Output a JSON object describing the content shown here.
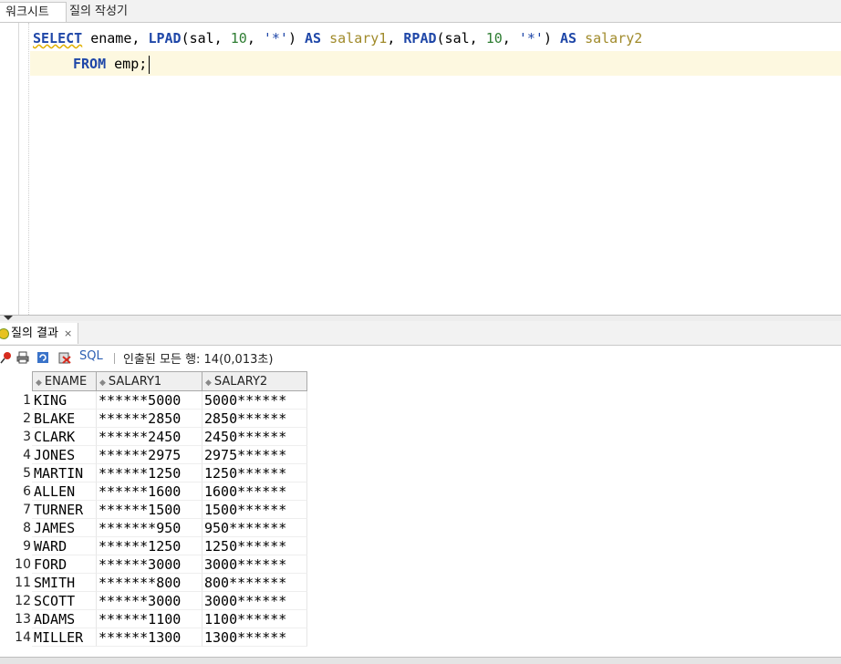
{
  "top_tabs": [
    "워크시트",
    "질의 작성기"
  ],
  "editor": {
    "line1": [
      {
        "t": "SELECT",
        "c": "kw squig"
      },
      {
        "t": " ename, ",
        "c": ""
      },
      {
        "t": "LPAD",
        "c": "kw"
      },
      {
        "t": "(sal, ",
        "c": ""
      },
      {
        "t": "10",
        "c": "num"
      },
      {
        "t": ", ",
        "c": ""
      },
      {
        "t": "'*'",
        "c": "str"
      },
      {
        "t": ") ",
        "c": ""
      },
      {
        "t": "AS",
        "c": "kw"
      },
      {
        "t": " ",
        "c": ""
      },
      {
        "t": "salary1",
        "c": "alias"
      },
      {
        "t": ", ",
        "c": ""
      },
      {
        "t": "RPAD",
        "c": "kw"
      },
      {
        "t": "(sal, ",
        "c": ""
      },
      {
        "t": "10",
        "c": "num"
      },
      {
        "t": ", ",
        "c": ""
      },
      {
        "t": "'*'",
        "c": "str"
      },
      {
        "t": ") ",
        "c": ""
      },
      {
        "t": "AS",
        "c": "kw"
      },
      {
        "t": " ",
        "c": ""
      },
      {
        "t": "salary2",
        "c": "alias"
      }
    ],
    "line2": [
      {
        "t": "FROM",
        "c": "kw"
      },
      {
        "t": " emp;",
        "c": ""
      }
    ]
  },
  "results": {
    "tab_label": "질의 결과",
    "close": "×",
    "sql_label": "SQL",
    "status": "인출된 모든 행: 14(0,013초)",
    "columns": [
      "ENAME",
      "SALARY1",
      "SALARY2"
    ],
    "rows": [
      [
        "1",
        "KING",
        "******5000",
        "5000******"
      ],
      [
        "2",
        "BLAKE",
        "******2850",
        "2850******"
      ],
      [
        "3",
        "CLARK",
        "******2450",
        "2450******"
      ],
      [
        "4",
        "JONES",
        "******2975",
        "2975******"
      ],
      [
        "5",
        "MARTIN",
        "******1250",
        "1250******"
      ],
      [
        "6",
        "ALLEN",
        "******1600",
        "1600******"
      ],
      [
        "7",
        "TURNER",
        "******1500",
        "1500******"
      ],
      [
        "8",
        "JAMES",
        "*******950",
        "950*******"
      ],
      [
        "9",
        "WARD",
        "******1250",
        "1250******"
      ],
      [
        "10",
        "FORD",
        "******3000",
        "3000******"
      ],
      [
        "11",
        "SMITH",
        "*******800",
        "800*******"
      ],
      [
        "12",
        "SCOTT",
        "******3000",
        "3000******"
      ],
      [
        "13",
        "ADAMS",
        "******1100",
        "1100******"
      ],
      [
        "14",
        "MILLER",
        "******1300",
        "1300******"
      ]
    ]
  }
}
